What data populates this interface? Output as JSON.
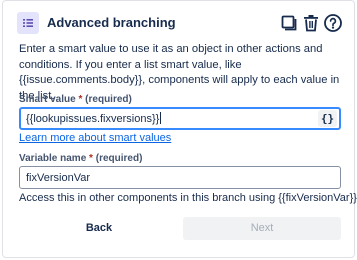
{
  "header": {
    "title": "Advanced branching",
    "icon": "list-icon",
    "actions": [
      "copy-icon",
      "delete-icon",
      "help-icon"
    ]
  },
  "description": "Enter a smart value to use it as an object in other actions and conditions. If you enter a list smart value, like {{issue.comments.body}}, components will apply to each value in the list.",
  "smart_value": {
    "label": "Smart value",
    "required_marker": "*",
    "required_text": "(required)",
    "value": "{{lookupissues.fixversions}}",
    "braces_button": "{}"
  },
  "learn_more_link": "Learn more about smart values",
  "variable_name": {
    "label": "Variable name",
    "required_marker": "*",
    "required_text": "(required)",
    "value": "fixVersionVar",
    "help": "Access this in other components in this branch using {{fixVersionVar}}"
  },
  "footer": {
    "back_label": "Back",
    "next_label": "Next"
  },
  "colors": {
    "accent": "#0c66e4",
    "focus_border": "#388bff",
    "icon_bg": "#e3e4fb",
    "icon_fg": "#5e4db2",
    "required": "#ae2e24"
  }
}
